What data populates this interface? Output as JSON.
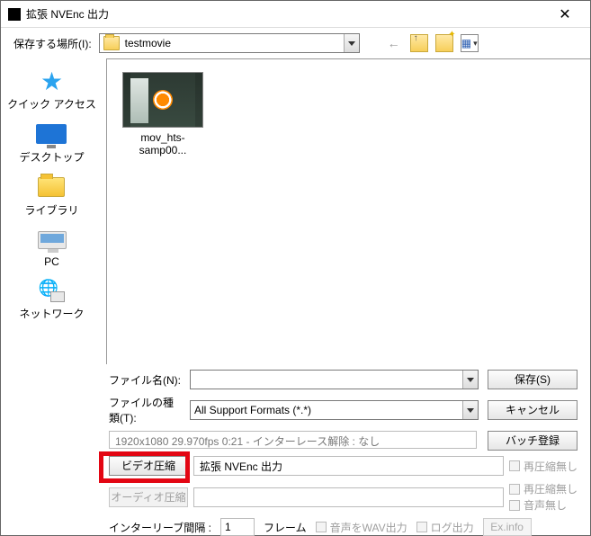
{
  "title": "拡張 NVEnc 出力",
  "location": {
    "label": "保存する場所(I):",
    "folder": "testmovie"
  },
  "sidebar": [
    {
      "label": "クイック アクセス"
    },
    {
      "label": "デスクトップ"
    },
    {
      "label": "ライブラリ"
    },
    {
      "label": "PC"
    },
    {
      "label": "ネットワーク"
    }
  ],
  "file_item": {
    "name": "mov_hts-samp00..."
  },
  "fields": {
    "filename_label": "ファイル名(N):",
    "filename_value": "",
    "filetype_label": "ファイルの種類(T):",
    "filetype_value": "All Support Formats (*.*)"
  },
  "buttons": {
    "save": "保存(S)",
    "cancel": "キャンセル",
    "batch": "バッチ登録",
    "video_compress": "ビデオ圧縮",
    "audio_compress": "オーディオ圧縮",
    "exinfo": "Ex.info"
  },
  "info_line": "1920x1080  29.970fps  0:21  -  インターレース解除 : なし",
  "video_codec_value": "拡張 NVEnc 出力",
  "audio_codec_value": "",
  "checks": {
    "no_recompress": "再圧縮無し",
    "no_recompress2": "再圧縮無し",
    "no_audio": "音声無し"
  },
  "interleave": {
    "label": "インターリーブ間隔 :",
    "value": "1",
    "unit": "フレーム",
    "wav_out": "音声をWAV出力",
    "log_out": "ログ出力"
  }
}
